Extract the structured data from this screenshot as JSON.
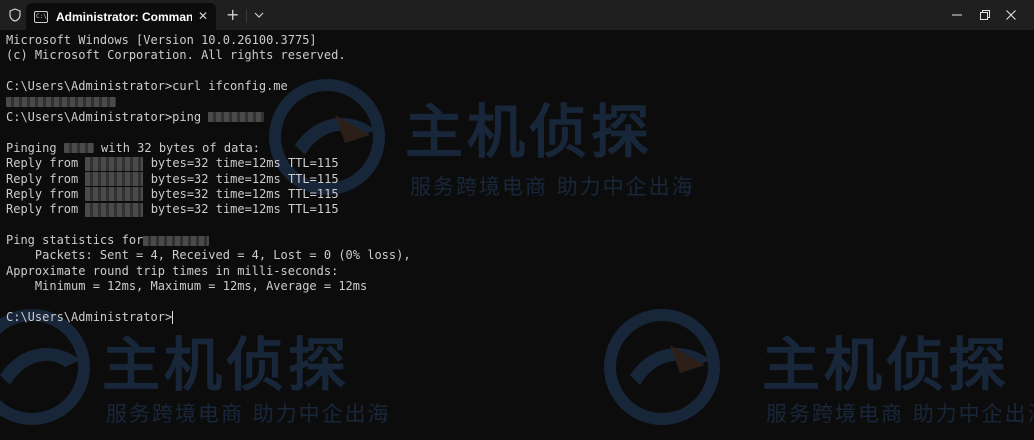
{
  "window": {
    "tab_title": "Administrator: Command Pro",
    "tab_close": "✕",
    "new_tab": "+",
    "colors": {
      "titlebar": "#1f1f1f",
      "background": "#0c0c0c",
      "text": "#cccccc"
    }
  },
  "terminal": {
    "lines": [
      "Microsoft Windows [Version 10.0.26100.3775]",
      "(c) Microsoft Corporation. All rights reserved.",
      "",
      "C:\\Users\\Administrator>curl ifconfig.me",
      "",
      "C:\\Users\\Administrator>ping ",
      "",
      "Pinging ",
      " with 32 bytes of data:",
      "Reply from ",
      " bytes=32 time=12ms TTL=115",
      "",
      "Ping statistics for",
      "    Packets: Sent = 4, Received = 4, Lost = 0 (0% loss),",
      "Approximate round trip times in milli-seconds:",
      "    Minimum = 12ms, Maximum = 12ms, Average = 12ms",
      "C:\\Users\\Administrator>"
    ]
  },
  "watermark": {
    "title": "主机侦探",
    "subtitle": "服务跨境电商 助力中企出海",
    "color": "#2a4a7a"
  }
}
